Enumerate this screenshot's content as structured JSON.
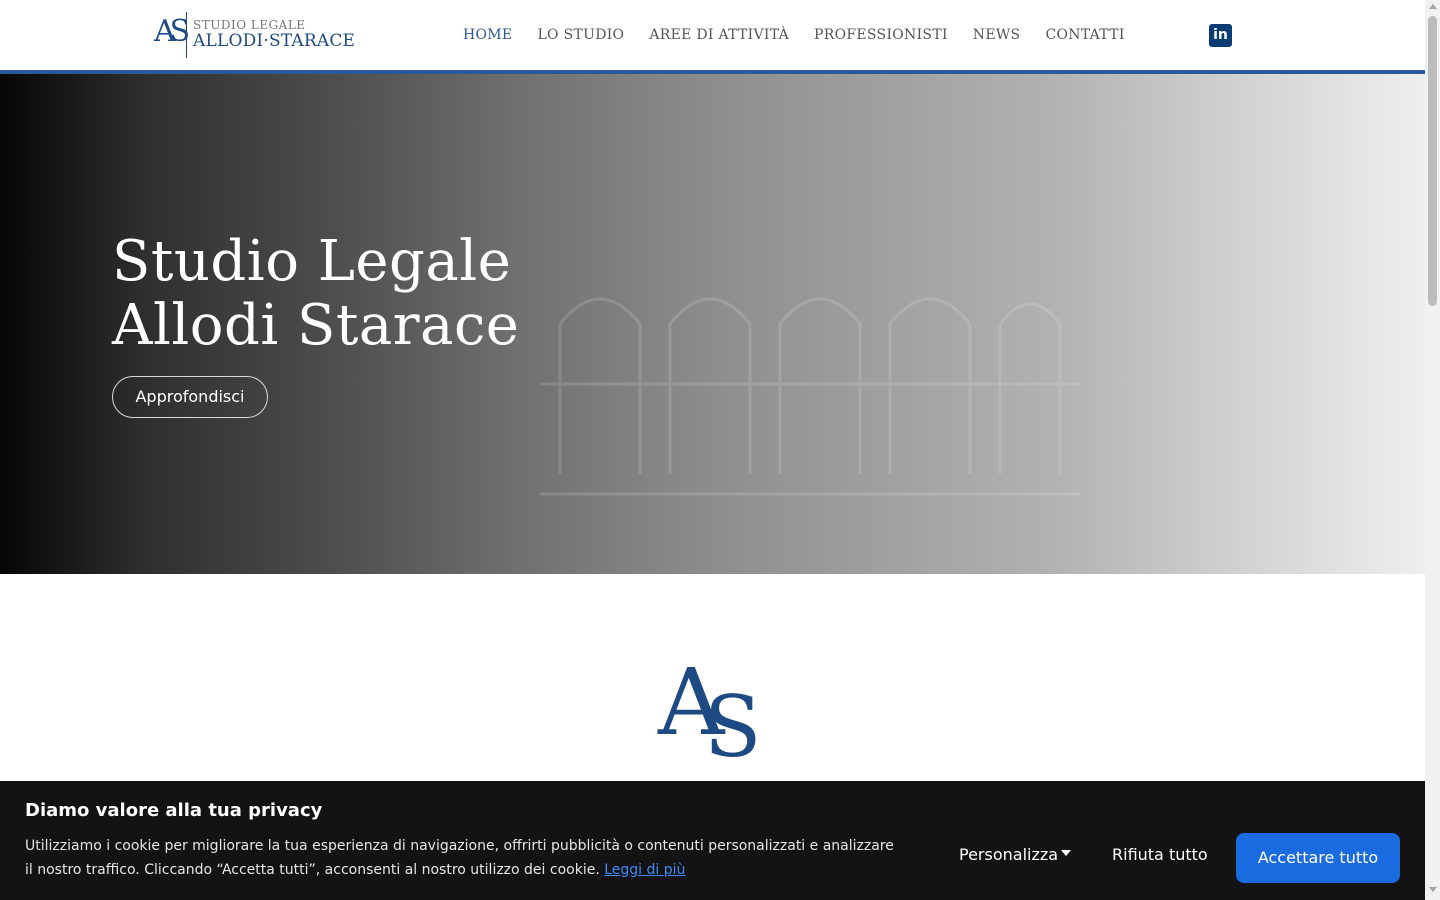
{
  "header": {
    "logo": {
      "monogram": "AS",
      "line1": "STUDIO LEGALE",
      "line2": "ALLODI·STARACE"
    },
    "nav": [
      {
        "label": "HOME",
        "active": true
      },
      {
        "label": "LO STUDIO",
        "active": false
      },
      {
        "label": "AREE DI ATTIVITÀ",
        "active": false
      },
      {
        "label": "PROFESSIONISTI",
        "active": false
      },
      {
        "label": "NEWS",
        "active": false
      },
      {
        "label": "CONTATTI",
        "active": false
      }
    ],
    "social_icon": "linkedin-icon",
    "social_glyph": "in"
  },
  "hero": {
    "title_line1": "Studio Legale",
    "title_line2": "Allodi Starace",
    "button_label": "Approfondisci"
  },
  "big_logo": "AS",
  "cookie": {
    "title": "Diamo valore alla tua privacy",
    "text": "Utilizziamo i cookie per migliorare la tua esperienza di navigazione, offrirti pubblicità o contenuti personalizzati e analizzare il nostro traffico. Cliccando “Accetta tutti”, acconsenti al nostro utilizzo dei cookie.",
    "link": "Leggi di più",
    "customize_label": "Personalizza",
    "reject_label": "Rifiuta tutto",
    "accept_label": "Accettare tutto"
  },
  "colors": {
    "brand_blue": "#1e4a84",
    "nav_active": "#2a5a95",
    "accept_button": "#1a6ae0",
    "cookie_bg": "#131313",
    "link": "#3d8bfd"
  }
}
